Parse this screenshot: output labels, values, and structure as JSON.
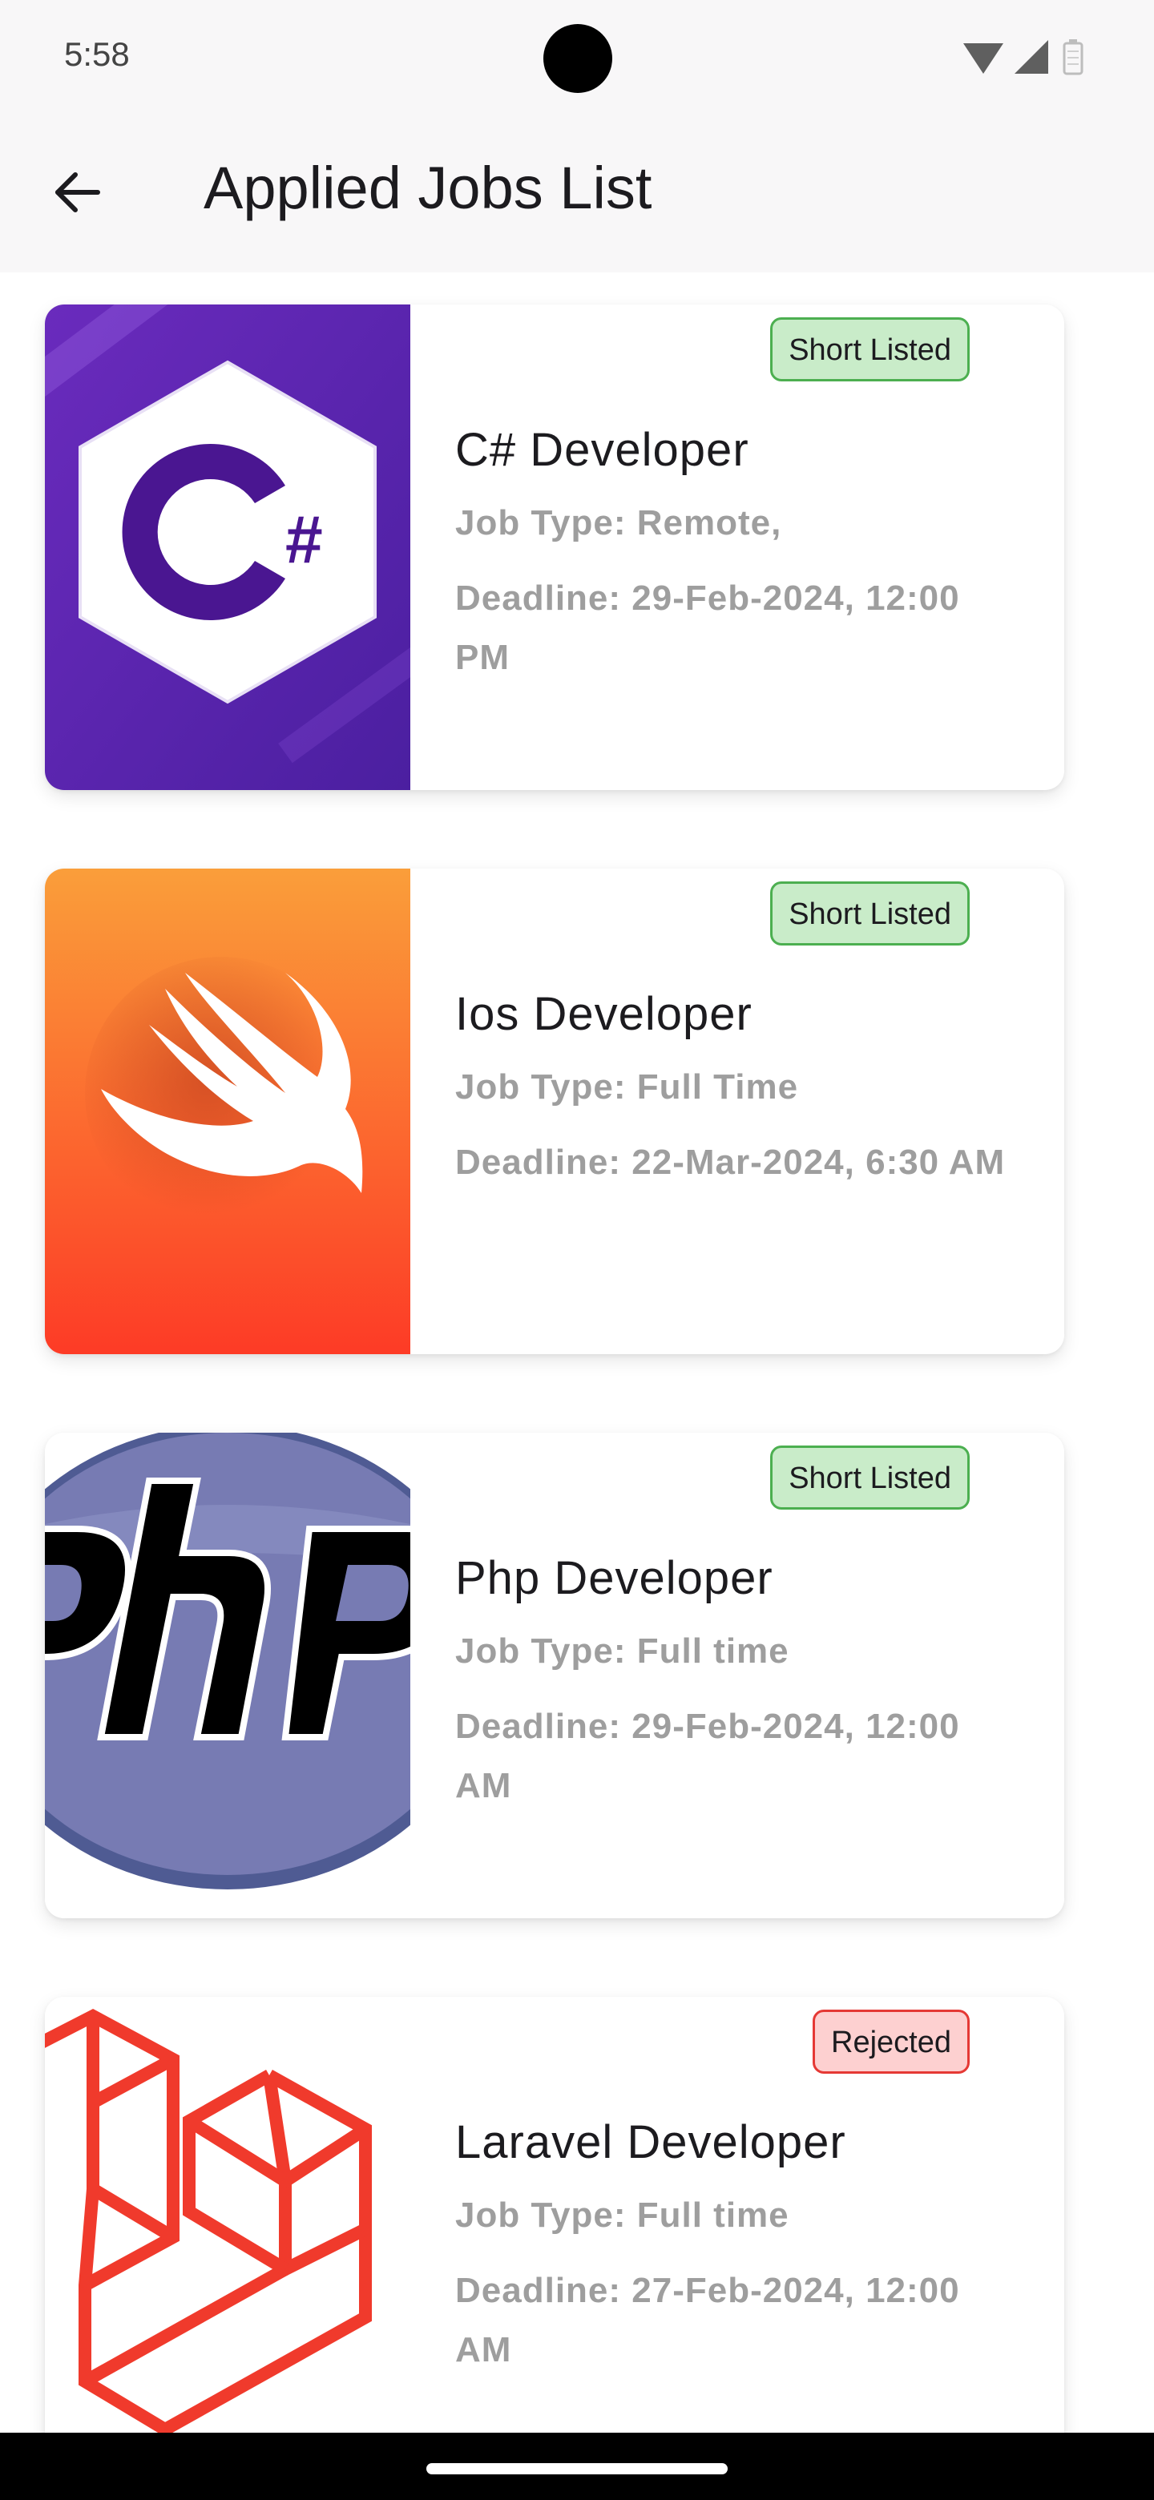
{
  "status_bar": {
    "time": "5:58",
    "icons": [
      "wifi-icon",
      "cellular-signal-icon",
      "battery-icon"
    ]
  },
  "app_bar": {
    "back_icon": "arrow-back-icon",
    "title": "Applied Jobs List"
  },
  "jobs": [
    {
      "logo": "csharp-logo",
      "status": "Short Listed",
      "status_color": "#4caf50",
      "title": "C# Developer",
      "job_type": "Job Type: Remote,",
      "deadline": "Deadline: 29-Feb-2024, 12:00 PM"
    },
    {
      "logo": "swift-logo",
      "status": "Short Listed",
      "status_color": "#4caf50",
      "title": "Ios Developer",
      "job_type": "Job Type: Full Time",
      "deadline": "Deadline: 22-Mar-2024, 6:30 AM"
    },
    {
      "logo": "php-logo",
      "status": "Short Listed",
      "status_color": "#4caf50",
      "title": "Php Developer",
      "job_type": "Job Type: Full time",
      "deadline": "Deadline: 29-Feb-2024, 12:00 AM"
    },
    {
      "logo": "laravel-logo",
      "status": "Rejected",
      "status_color": "#e53935",
      "title": "Laravel Developer",
      "job_type": "Job Type: Full time",
      "deadline": "Deadline: 27-Feb-2024, 12:00 AM"
    }
  ],
  "colors": {
    "app_bar_bg": "#f8f7f8",
    "title_text": "#1c1b1f",
    "secondary_text": "#9e9e9e",
    "shortlisted_bg": "#c9ecc9",
    "rejected_bg": "#fdd0d0"
  }
}
